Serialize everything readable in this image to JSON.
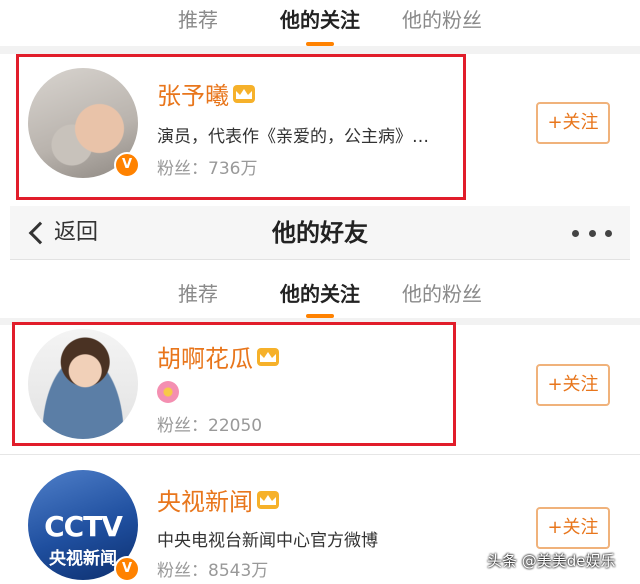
{
  "tabs_top": [
    "推荐",
    "他的关注",
    "他的粉丝"
  ],
  "tabs_bottom": [
    "推荐",
    "他的关注",
    "他的粉丝"
  ],
  "active_tab_index": 1,
  "nav": {
    "back_label": "返回",
    "title": "他的好友"
  },
  "users": [
    {
      "name": "张予曦",
      "desc": "演员，代表作《亲爱的，公主病》…",
      "fans": "粉丝：736万",
      "follow_label": "+关注",
      "verified_mark": "V"
    },
    {
      "name": "胡啊花瓜",
      "desc": "",
      "fans": "粉丝：22050",
      "follow_label": "+关注"
    },
    {
      "name": "央视新闻",
      "desc": "中央电视台新闻中心官方微博",
      "fans": "粉丝：8543万",
      "follow_label": "+关注",
      "verified_mark": "V",
      "avatar_text": "CCTV",
      "avatar_sub": "央视新闻"
    }
  ],
  "watermark": "头条 @美美de娱乐",
  "colors": {
    "accent": "#ff8200",
    "name": "#e8761c",
    "highlight_box": "#e11d2a"
  }
}
